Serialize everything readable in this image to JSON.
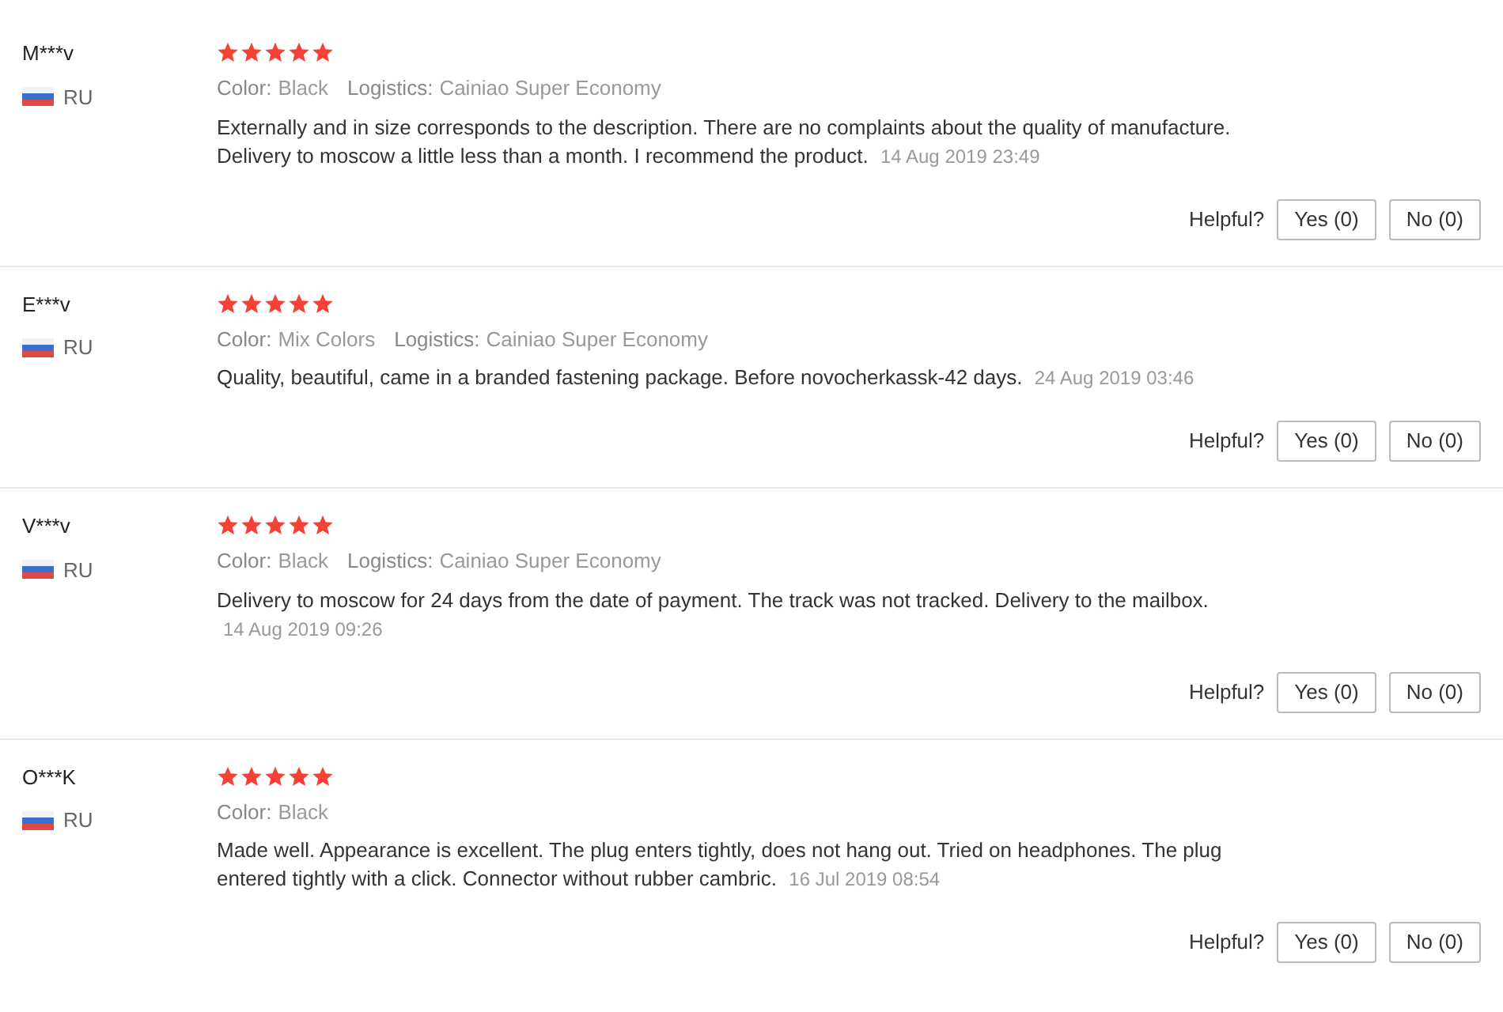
{
  "reviews": [
    {
      "name": "M***v",
      "country": "RU",
      "stars": 5,
      "attributes": [
        {
          "label": "Color:",
          "value": "Black"
        },
        {
          "label": "Logistics:",
          "value": "Cainiao Super Economy"
        }
      ],
      "text": "Externally and in size corresponds to the description. There are no complaints about the quality of manufacture. Delivery to moscow a little less than a month. I recommend the product.",
      "date": "14 Aug 2019 23:49",
      "helpful": "Helpful?",
      "yes": "Yes (0)",
      "no": "No (0)"
    },
    {
      "name": "E***v",
      "country": "RU",
      "stars": 5,
      "attributes": [
        {
          "label": "Color:",
          "value": "Mix Colors"
        },
        {
          "label": "Logistics:",
          "value": "Cainiao Super Economy"
        }
      ],
      "text": "Quality, beautiful, came in a branded fastening package. Before novocherkassk-42 days.",
      "date": "24 Aug 2019 03:46",
      "helpful": "Helpful?",
      "yes": "Yes (0)",
      "no": "No (0)"
    },
    {
      "name": "V***v",
      "country": "RU",
      "stars": 5,
      "attributes": [
        {
          "label": "Color:",
          "value": "Black"
        },
        {
          "label": "Logistics:",
          "value": "Cainiao Super Economy"
        }
      ],
      "text": "Delivery to moscow for 24 days from the date of payment. The track was not tracked. Delivery to the mailbox.",
      "date": "14 Aug 2019 09:26",
      "helpful": "Helpful?",
      "yes": "Yes (0)",
      "no": "No (0)"
    },
    {
      "name": "O***K",
      "country": "RU",
      "stars": 5,
      "attributes": [
        {
          "label": "Color:",
          "value": "Black"
        }
      ],
      "text": "Made well. Appearance is excellent. The plug enters tightly, does not hang out. Tried on headphones. The plug entered tightly with a click. Connector without rubber cambric.",
      "date": "16 Jul 2019 08:54",
      "helpful": "Helpful?",
      "yes": "Yes (0)",
      "no": "No (0)"
    }
  ]
}
